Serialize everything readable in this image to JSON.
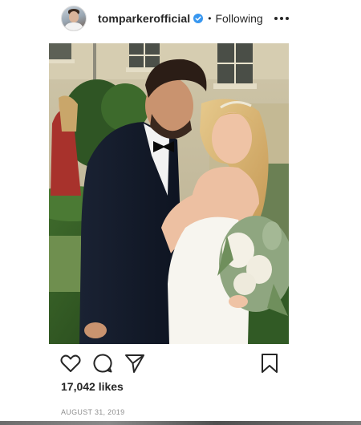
{
  "post": {
    "username": "tomparkerofficial",
    "separator": "•",
    "follow_status": "Following",
    "likes": "17,042 likes",
    "date": "AUGUST 31, 2019"
  },
  "icons": {
    "verified": "verified-badge-icon",
    "more": "more-options-icon",
    "like": "heart-icon",
    "comment": "comment-icon",
    "share": "share-icon",
    "save": "bookmark-icon"
  },
  "colors": {
    "text": "#262626",
    "verified": "#3897f0",
    "muted": "#8e8e8e"
  }
}
